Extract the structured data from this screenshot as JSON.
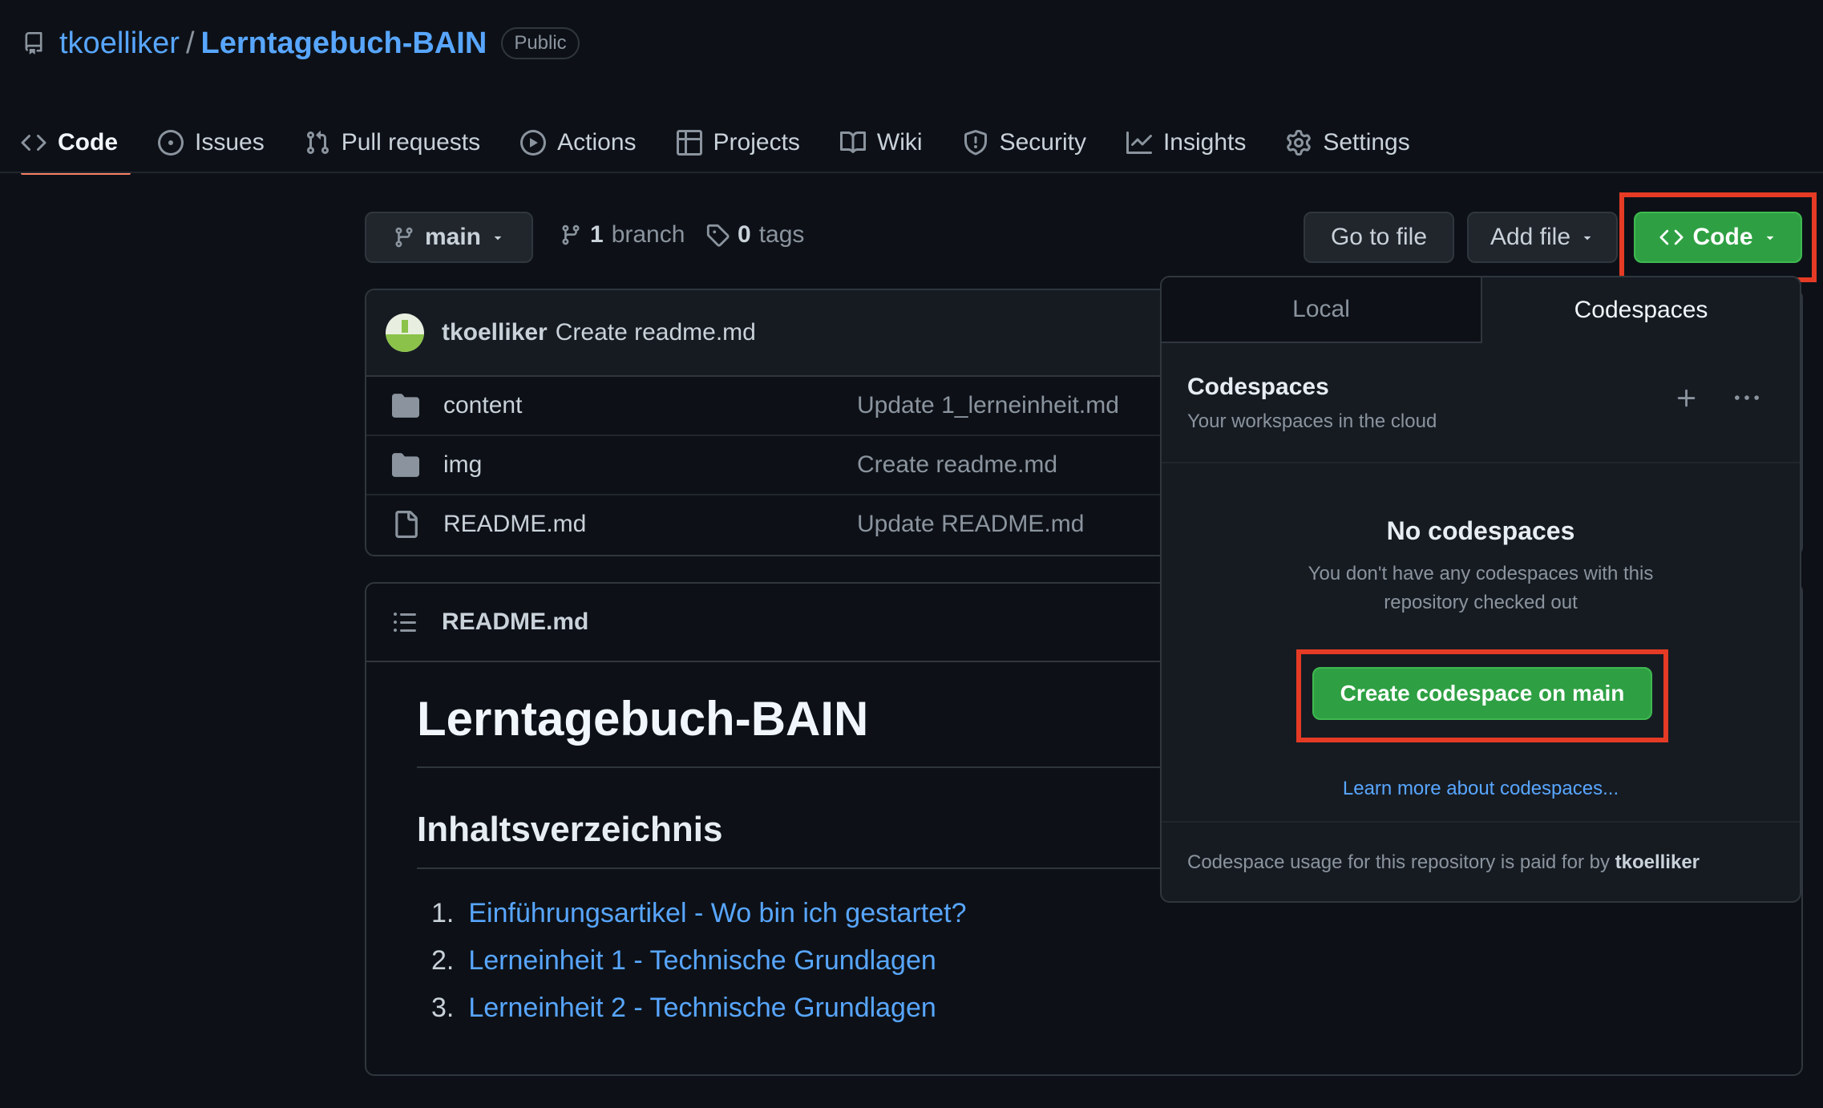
{
  "repo": {
    "owner": "tkoelliker",
    "separator": "/",
    "name": "Lerntagebuch-BAIN",
    "visibility": "Public"
  },
  "nav": [
    {
      "label": "Code",
      "icon": "code-icon",
      "active": true
    },
    {
      "label": "Issues",
      "icon": "issue-icon"
    },
    {
      "label": "Pull requests",
      "icon": "pull-request-icon"
    },
    {
      "label": "Actions",
      "icon": "play-icon"
    },
    {
      "label": "Projects",
      "icon": "table-icon"
    },
    {
      "label": "Wiki",
      "icon": "book-icon"
    },
    {
      "label": "Security",
      "icon": "shield-icon"
    },
    {
      "label": "Insights",
      "icon": "graph-icon"
    },
    {
      "label": "Settings",
      "icon": "gear-icon"
    }
  ],
  "toolbar": {
    "branch": "main",
    "branch_count": "1",
    "branch_label": "branch",
    "tag_count": "0",
    "tag_label": "tags",
    "go_to_file": "Go to file",
    "add_file": "Add file",
    "code": "Code"
  },
  "commit": {
    "author": "tkoelliker",
    "message": "Create readme.md"
  },
  "files": [
    {
      "name": "content",
      "type": "folder",
      "message": "Update 1_lerneinheit.md"
    },
    {
      "name": "img",
      "type": "folder",
      "message": "Create readme.md"
    },
    {
      "name": "README.md",
      "type": "file",
      "message": "Update README.md"
    }
  ],
  "readme": {
    "filename": "README.md",
    "title": "Lerntagebuch-BAIN",
    "toc_heading": "Inhaltsverzeichnis",
    "toc": [
      {
        "num": "1.",
        "label": "Einführungsartikel - Wo bin ich gestartet?"
      },
      {
        "num": "2.",
        "label": "Lerneinheit 1 - Technische Grundlagen"
      },
      {
        "num": "3.",
        "label": "Lerneinheit 2 - Technische Grundlagen"
      }
    ]
  },
  "dropdown": {
    "tab_local": "Local",
    "tab_codespaces": "Codespaces",
    "heading": "Codespaces",
    "subheading": "Your workspaces in the cloud",
    "empty_title": "No codespaces",
    "empty_line1": "You don't have any codespaces with this",
    "empty_line2": "repository checked out",
    "create_button": "Create codespace on main",
    "learn_more": "Learn more about codespaces...",
    "footer_text": "Codespace usage for this repository is paid for by",
    "footer_user": "tkoelliker"
  },
  "colors": {
    "accent_green": "#2ea043",
    "link": "#58a6ff",
    "highlight_red": "#e53b25",
    "tab_underline": "#f78166"
  }
}
